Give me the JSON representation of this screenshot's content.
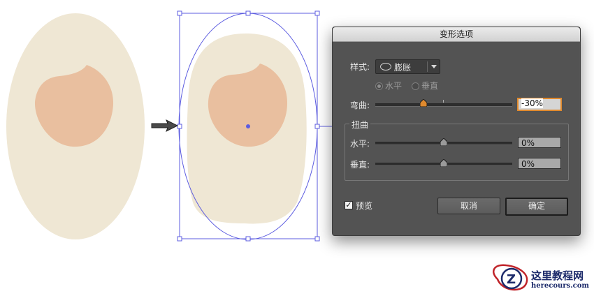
{
  "colors": {
    "egg_white": "#efe7d4",
    "yolk": "#e9bf9f",
    "selection_blue": "#5c5ce0",
    "dialog_bg": "#535353",
    "focus_orange": "#e08a2e"
  },
  "dialog": {
    "title": "变形选项",
    "style_label": "样式:",
    "style_value": "膨胀",
    "orientation": {
      "horizontal": "水平",
      "vertical": "垂直",
      "selected": "horizontal"
    },
    "bend": {
      "label": "弯曲:",
      "value": "-30%",
      "level_percent": -30
    },
    "distortion": {
      "group_title": "扭曲",
      "horizontal": {
        "label": "水平:",
        "value": "0%",
        "level_percent": 0
      },
      "vertical": {
        "label": "垂直:",
        "value": "0%",
        "level_percent": 0
      }
    },
    "preview": {
      "label": "预览",
      "checked": true,
      "check_glyph": "✓"
    },
    "cancel_label": "取消",
    "ok_label": "确定"
  },
  "icons": {
    "arrow": "right-arrow-icon",
    "ellipse": "ellipse-icon",
    "dropdown": "chevron-down-icon"
  },
  "watermark": {
    "letter": "Z",
    "text": "这里教程网",
    "url": "herecours.com"
  }
}
